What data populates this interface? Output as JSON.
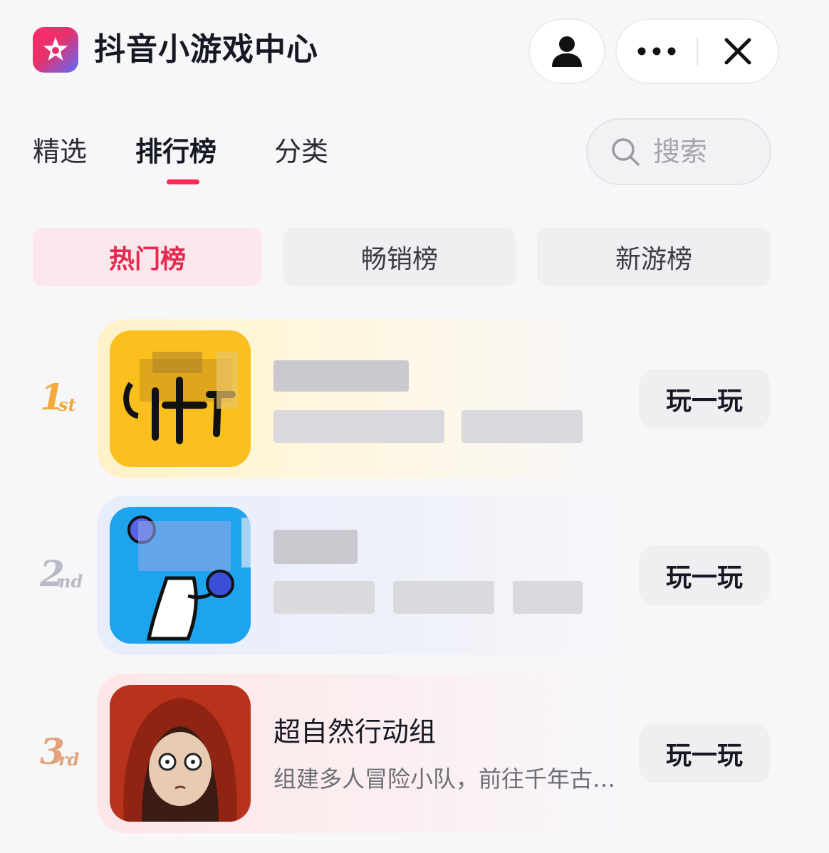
{
  "header": {
    "title": "抖音小游戏中心",
    "logo_icon": "douyin-game-star-logo",
    "buttons": [
      "profile-icon",
      "more-icon",
      "close-icon"
    ]
  },
  "tabs": [
    {
      "label": "精选",
      "active": false
    },
    {
      "label": "排行榜",
      "active": true
    },
    {
      "label": "分类",
      "active": false
    }
  ],
  "search": {
    "placeholder": "搜索",
    "icon": "search-icon"
  },
  "segments": [
    {
      "label": "热门榜",
      "active": true
    },
    {
      "label": "畅销榜",
      "active": false
    },
    {
      "label": "新游榜",
      "active": false
    }
  ],
  "rankings": [
    {
      "rank": "1",
      "suffix": "st",
      "name": "",
      "desc": "",
      "name_redacted": true,
      "play_label": "玩一玩"
    },
    {
      "rank": "2",
      "suffix": "nd",
      "name": "",
      "desc": "",
      "name_redacted": true,
      "play_label": "玩一玩"
    },
    {
      "rank": "3",
      "suffix": "rd",
      "name": "超自然行动组",
      "desc": "组建多人冒险小队，前往千年古…",
      "name_redacted": false,
      "play_label": "玩一玩"
    }
  ],
  "colors": {
    "accent": "#fe2c55",
    "active_segment_bg": "#fce8ec",
    "gold": "#f4a93a",
    "silver": "#b9bcc6",
    "bronze": "#e2a27a"
  }
}
